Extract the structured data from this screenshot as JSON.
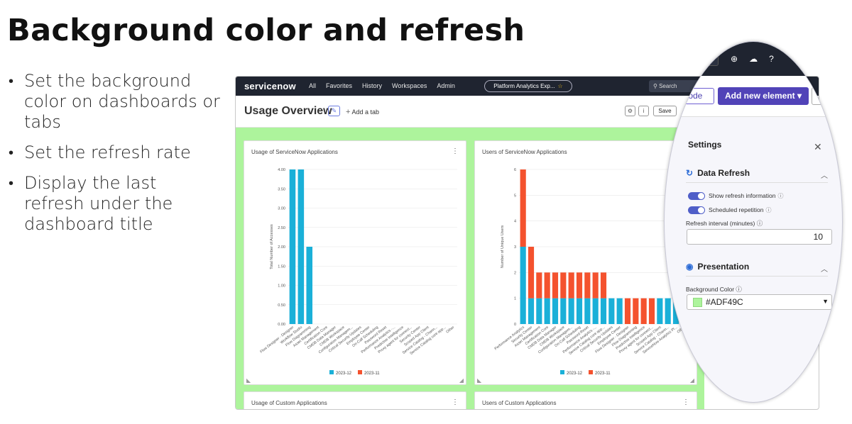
{
  "slide": {
    "title": "Background color and refresh",
    "bullets": [
      "Set the background color on dashboards or tabs",
      "Set the refresh rate",
      "Display the last refresh under the dashboard title"
    ]
  },
  "app": {
    "logo": "servicenow",
    "nav": [
      "All",
      "Favorites",
      "History",
      "Workspaces",
      "Admin"
    ],
    "workspace_pill": "Platform Analytics Exp...",
    "search_placeholder": "Search"
  },
  "dashboard": {
    "title": "Usage Overview",
    "add_tab": "Add a tab",
    "save": "Save",
    "background_color": "#ADF49C"
  },
  "widgets": {
    "w1_title": "Usage of ServiceNow Applications",
    "w2_title": "Users of ServiceNow Applications",
    "w3_title": "Usage of Custom Applications",
    "w4_title": "Users of Custom Applications"
  },
  "chart_data": [
    {
      "type": "bar",
      "title": "Usage of ServiceNow Applications",
      "ylabel": "Total Number of Accesses",
      "ylim": [
        0,
        4
      ],
      "yticks": [
        "0.00",
        "0.50",
        "1.00",
        "1.50",
        "2.00",
        "2.50",
        "3.00",
        "3.50",
        "4.00"
      ],
      "categories": [
        "Flow Designer - Designer",
        "Workflow Studio",
        "Flow Diagramming",
        "Asset Management",
        "Certification Core",
        "CMDB Data Manager",
        "CMDB Workspace",
        "Configuration Managem...",
        "Critical Security Updates",
        "Employee Center",
        "On-Call Scheduling",
        "Password Reset",
        "Performance Analytics -...",
        "Predictive Intelligence",
        "Proxy agent for connect...",
        "Security Center",
        "Scoped App Client",
        "Service Catalog - Chann...",
        "Service Catalog core app...",
        "Other"
      ],
      "series": [
        {
          "name": "2023-12",
          "color": "#1ab0d8",
          "values": [
            4,
            4,
            2,
            0,
            0,
            0,
            0,
            0,
            0,
            0,
            0,
            0,
            0,
            0,
            0,
            0,
            0,
            0,
            0,
            0
          ]
        },
        {
          "name": "2023-11",
          "color": "#f4522e",
          "values": [
            0,
            0,
            0,
            0,
            0,
            0,
            0,
            0,
            0,
            0,
            0,
            0,
            0,
            0,
            0,
            0,
            0,
            0,
            0,
            0
          ]
        }
      ]
    },
    {
      "type": "bar",
      "title": "Users of ServiceNow Applications",
      "ylabel": "Number of Unique Users",
      "ylim": [
        0,
        6
      ],
      "yticks": [
        "0",
        "1",
        "2",
        "3",
        "4",
        "5",
        "6"
      ],
      "categories": [
        "Performance Analytics",
        "Security Center",
        "Asset Management",
        "Certification Core",
        "CMDB Data Manager",
        "CMDB Workspace",
        "Configuration Managem...",
        "On-Call Scheduling",
        "Password Reset",
        "Performance Analytics -...",
        "Service Catalog core app...",
        "Critical Security Updates",
        "Employee Center",
        "Flow Designer - Designer",
        "Flow Diagramming",
        "Predictive Intelligence",
        "Proxy agent for connect...",
        "Scoped App Client",
        "Service Catalog - Chann...",
        "ServiceNow Analytics Pl...",
        "Other"
      ],
      "stacked": true,
      "series": [
        {
          "name": "2023-12",
          "color": "#1ab0d8",
          "values": [
            3,
            1,
            1,
            1,
            1,
            1,
            1,
            1,
            1,
            1,
            1,
            1,
            1,
            0,
            0,
            0,
            0,
            1,
            1,
            1,
            0
          ]
        },
        {
          "name": "2023-11",
          "color": "#f4522e",
          "values": [
            3,
            2,
            1,
            1,
            1,
            1,
            1,
            1,
            1,
            1,
            1,
            0,
            0,
            1,
            1,
            1,
            1,
            0,
            0,
            0,
            1
          ]
        }
      ]
    }
  ],
  "settings": {
    "title": "Settings",
    "mode_button": "node",
    "add_element": "Add new element",
    "data_refresh": "Data Refresh",
    "show_refresh_info": "Show refresh information",
    "scheduled_repetition": "Scheduled repetition",
    "refresh_interval_label": "Refresh interval (minutes)",
    "refresh_interval_value": "10",
    "presentation": "Presentation",
    "background_color_label": "Background Color",
    "background_color_value": "#ADF49C"
  }
}
